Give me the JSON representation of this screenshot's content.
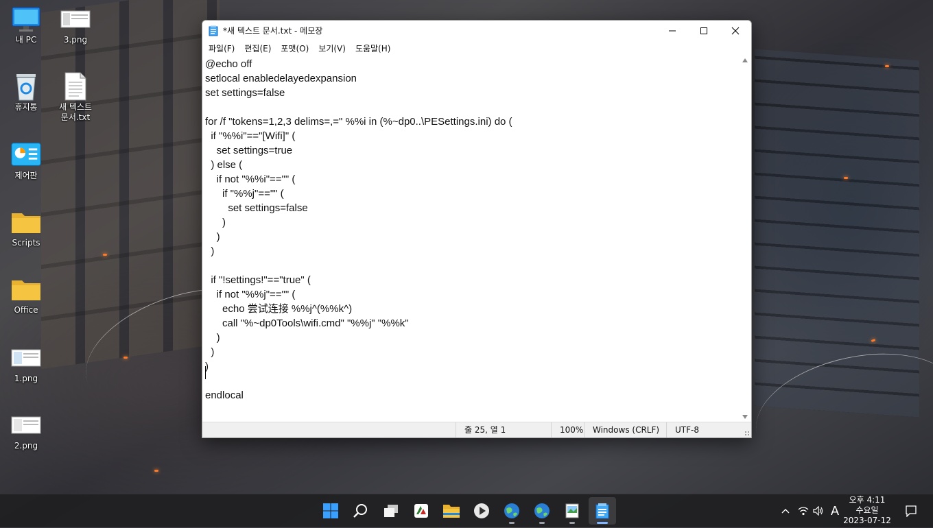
{
  "desktop": {
    "icons": [
      {
        "label": "내 PC",
        "icon": "monitor-icon"
      },
      {
        "label": "3.png",
        "icon": "image-file-icon"
      },
      {
        "label": "휴지통",
        "icon": "recycle-bin-icon"
      },
      {
        "label": "새 텍스트\n문서.txt",
        "icon": "text-file-icon"
      },
      {
        "label": "제어판",
        "icon": "control-panel-icon"
      },
      {
        "label": "Scripts",
        "icon": "folder-icon"
      },
      {
        "label": "Office",
        "icon": "folder-icon"
      },
      {
        "label": "1.png",
        "icon": "image-file-icon"
      },
      {
        "label": "2.png",
        "icon": "image-file-icon"
      }
    ]
  },
  "notepad": {
    "title": "*새 텍스트 문서.txt - 메모장",
    "menu": [
      "파일(F)",
      "편집(E)",
      "포맷(O)",
      "보기(V)",
      "도움말(H)"
    ],
    "lines": [
      "@echo off",
      "setlocal enabledelayedexpansion",
      "set settings=false",
      "",
      "for /f \"tokens=1,2,3 delims=,=\" %%i in (%~dp0..\\PESettings.ini) do (",
      "  if \"%%i\"==\"[Wifi]\" (",
      "    set settings=true",
      "  ) else (",
      "    if not \"%%i\"==\"\" (",
      "      if \"%%j\"==\"\" (",
      "        set settings=false",
      "      )",
      "    )",
      "  )",
      "",
      "  if \"!settings!\"==\"true\" (",
      "    if not \"%%j\"==\"\" (",
      "      echo 尝试连接 %%j^(%%k^)",
      "      call \"%~dp0Tools\\wifi.cmd\" \"%%j\" \"%%k\"",
      "    )",
      "  )",
      ")",
      "",
      "endlocal",
      ""
    ],
    "status": {
      "position": "줄 25, 열 1",
      "zoom": "100%",
      "line_ending": "Windows (CRLF)",
      "encoding": "UTF-8"
    }
  },
  "taskbar": {
    "apps": [
      "windows-start-icon",
      "search-icon",
      "task-view-icon",
      "app-icon",
      "file-explorer-icon",
      "media-player-icon",
      "globe-icon",
      "globe-icon",
      "image-viewer-icon",
      "notepad-icon"
    ],
    "ime": "A",
    "clock": {
      "time": "오후 4:11",
      "day": "수요일",
      "date": "2023-07-12"
    }
  },
  "colors": {
    "accent": "#0078d4",
    "taskbar": "#202022",
    "folder": "#f5c542"
  }
}
